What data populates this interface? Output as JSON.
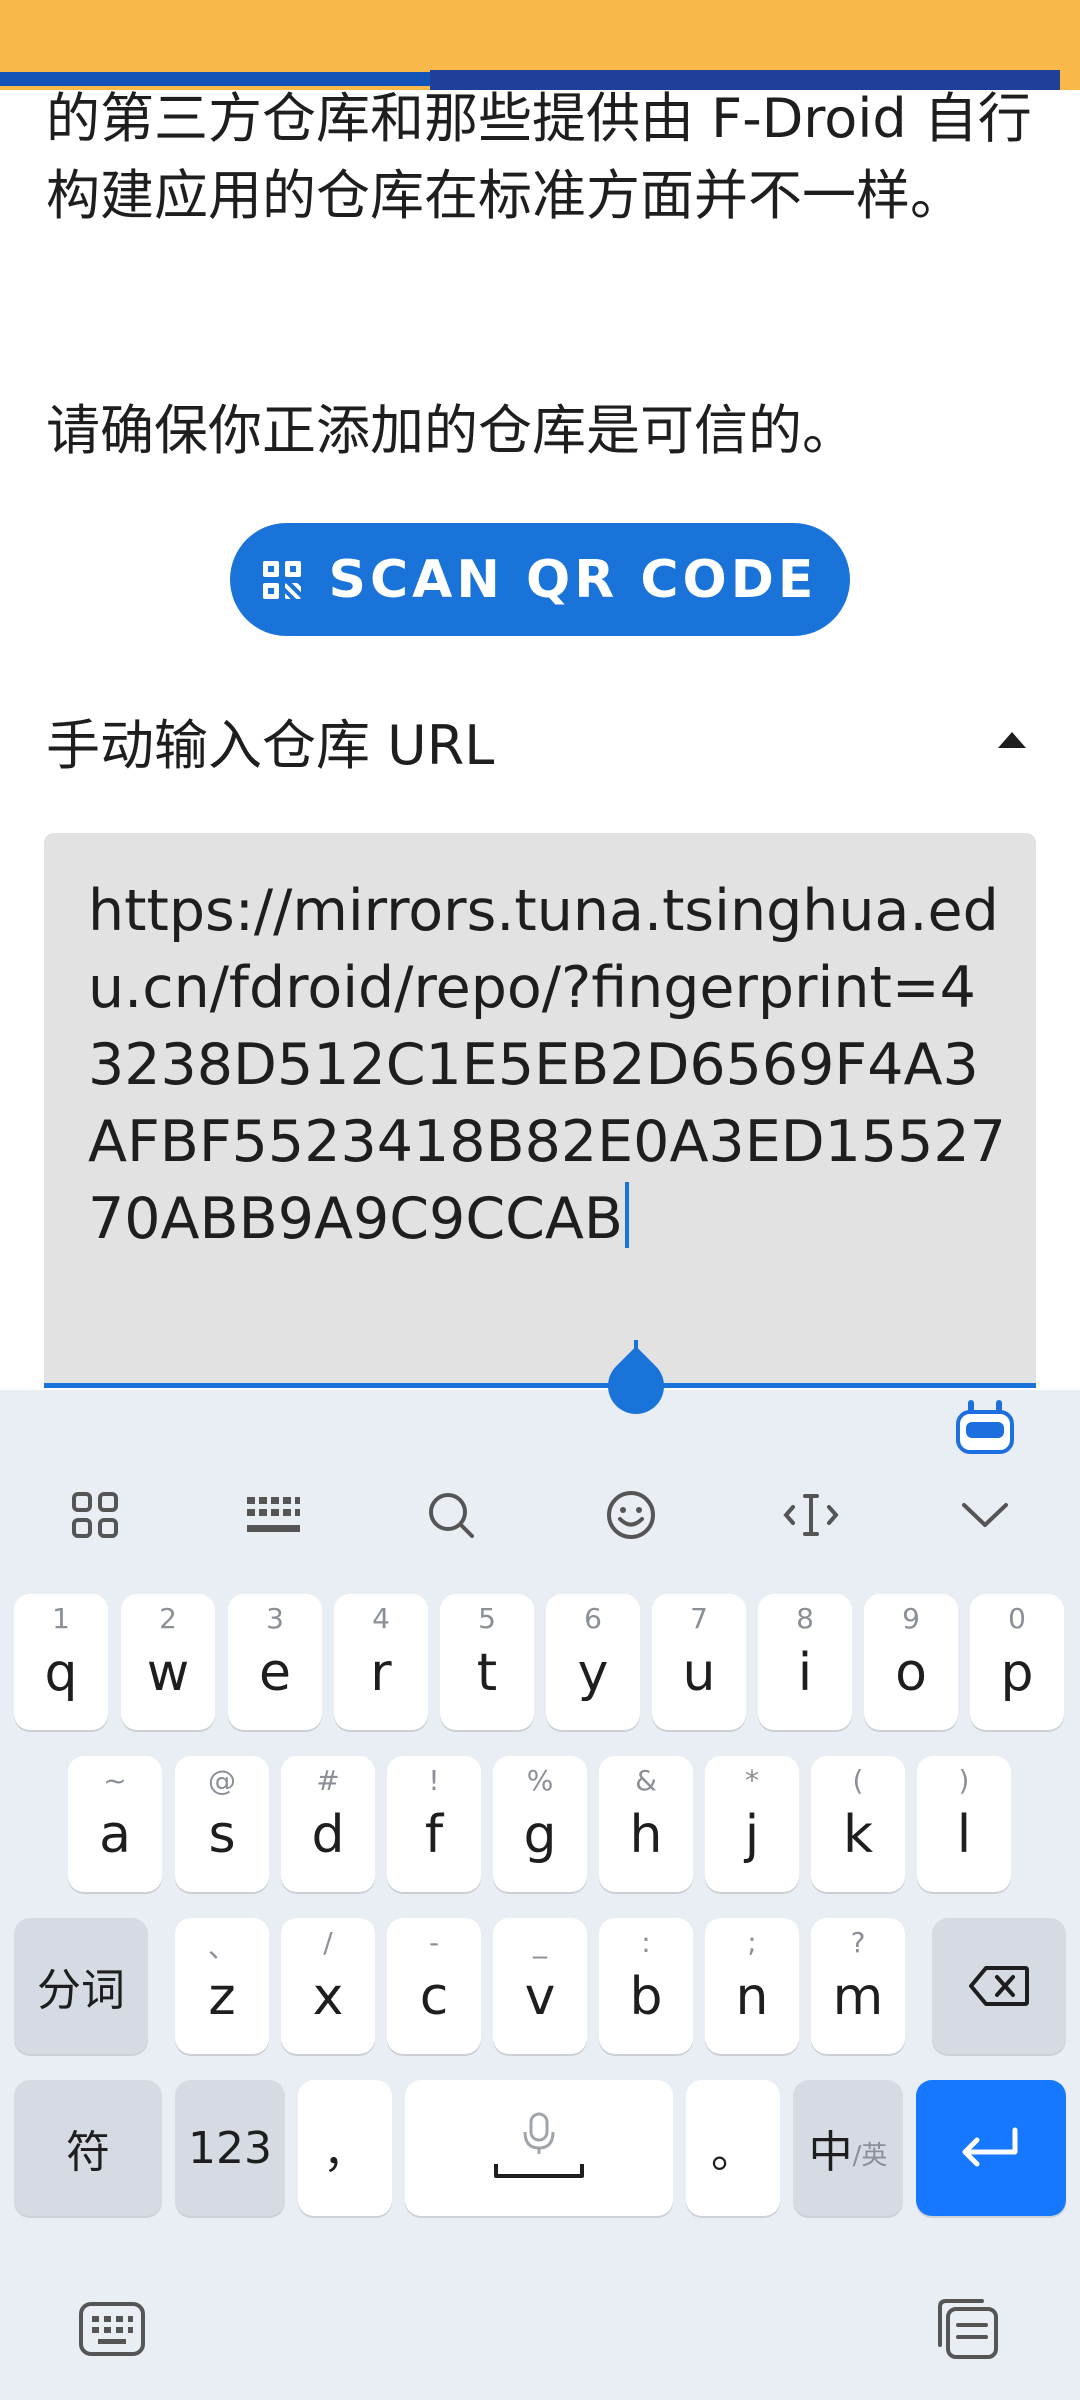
{
  "content": {
    "para1": "的第三方仓库和那些提供由 F-Droid 自行构建应用的仓库在标准方面并不一样。",
    "para2": "请确保你正添加的仓库是可信的。",
    "scan_button": "SCAN QR CODE",
    "section_title": "手动输入仓库 URL",
    "url_value": "https://mirrors.tuna.tsinghua.edu.cn/fdroid/repo/?fingerprint=43238D512C1E5EB2D6569F4A3AFBF5523418B82E0A3ED1552770ABB9A9C9CCAB"
  },
  "keyboard": {
    "row1": [
      {
        "hint": "1",
        "key": "q"
      },
      {
        "hint": "2",
        "key": "w"
      },
      {
        "hint": "3",
        "key": "e"
      },
      {
        "hint": "4",
        "key": "r"
      },
      {
        "hint": "5",
        "key": "t"
      },
      {
        "hint": "6",
        "key": "y"
      },
      {
        "hint": "7",
        "key": "u"
      },
      {
        "hint": "8",
        "key": "i"
      },
      {
        "hint": "9",
        "key": "o"
      },
      {
        "hint": "0",
        "key": "p"
      }
    ],
    "row2": [
      {
        "hint": "~",
        "key": "a"
      },
      {
        "hint": "@",
        "key": "s"
      },
      {
        "hint": "#",
        "key": "d"
      },
      {
        "hint": "!",
        "key": "f"
      },
      {
        "hint": "%",
        "key": "g"
      },
      {
        "hint": "&",
        "key": "h"
      },
      {
        "hint": "*",
        "key": "j"
      },
      {
        "hint": "(",
        "key": "k"
      },
      {
        "hint": ")",
        "key": "l"
      }
    ],
    "row3": [
      {
        "hint": "、",
        "key": "z"
      },
      {
        "hint": "/",
        "key": "x"
      },
      {
        "hint": "-",
        "key": "c"
      },
      {
        "hint": "_",
        "key": "v"
      },
      {
        "hint": ":",
        "key": "b"
      },
      {
        "hint": ";",
        "key": "n"
      },
      {
        "hint": "?",
        "key": "m"
      }
    ],
    "fenci_label": "分词",
    "fu_label": "符",
    "num_label": "123",
    "comma_label": "，",
    "period_label": "。",
    "lang_main": "中",
    "lang_sub": "/英"
  }
}
